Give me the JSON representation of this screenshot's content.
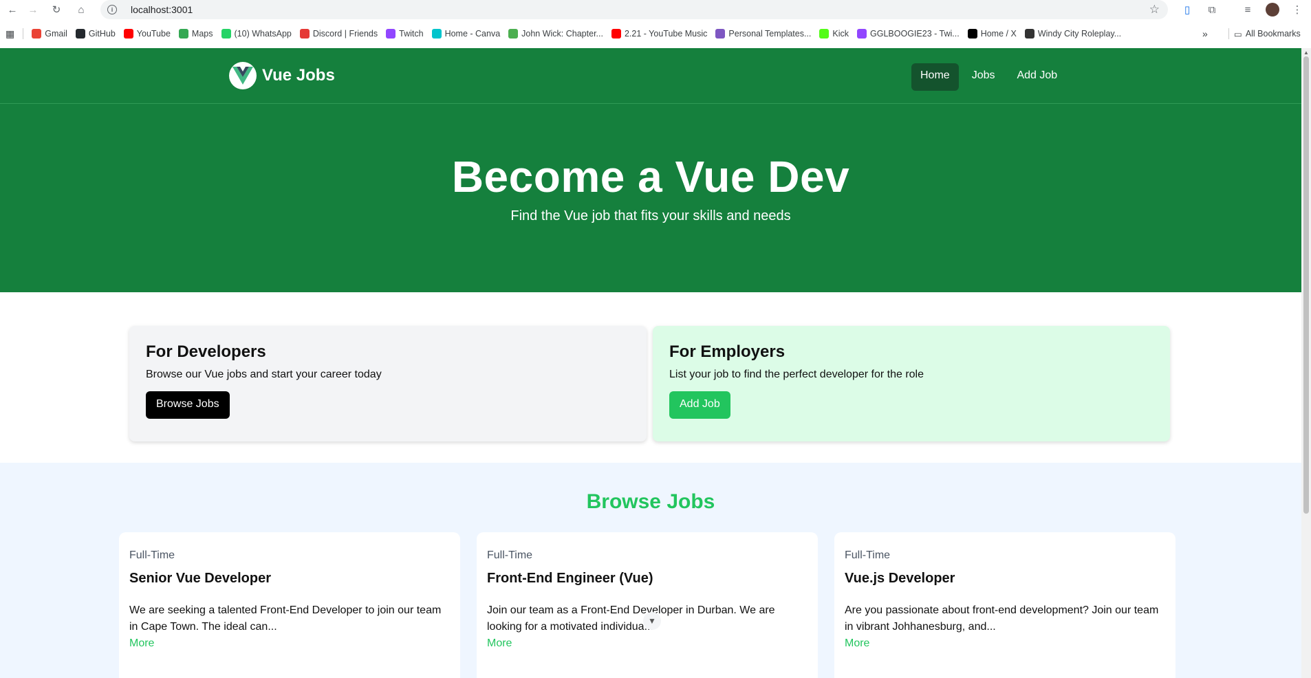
{
  "browser": {
    "url": "localhost:3001",
    "bookmarks": [
      {
        "label": "Gmail",
        "color": "#ea4335"
      },
      {
        "label": "GitHub",
        "color": "#24292e"
      },
      {
        "label": "YouTube",
        "color": "#ff0000"
      },
      {
        "label": "Maps",
        "color": "#34a853"
      },
      {
        "label": "(10) WhatsApp",
        "color": "#25d366"
      },
      {
        "label": "Discord | Friends",
        "color": "#e53935"
      },
      {
        "label": "Twitch",
        "color": "#9146ff"
      },
      {
        "label": "Home - Canva",
        "color": "#00c4cc"
      },
      {
        "label": "John Wick: Chapter...",
        "color": "#4caf50"
      },
      {
        "label": "2.21 - YouTube Music",
        "color": "#ff0000"
      },
      {
        "label": "Personal Templates...",
        "color": "#7e57c2"
      },
      {
        "label": "Kick",
        "color": "#53fc18"
      },
      {
        "label": "GGLBOOGIE23 - Twi...",
        "color": "#9146ff"
      },
      {
        "label": "Home / X",
        "color": "#000000"
      },
      {
        "label": "Windy City Roleplay...",
        "color": "#333333"
      }
    ],
    "all_bookmarks": "All Bookmarks"
  },
  "navbar": {
    "brand": "Vue Jobs",
    "links": [
      "Home",
      "Jobs",
      "Add Job"
    ],
    "active": "Home"
  },
  "hero": {
    "title": "Become a Vue Dev",
    "subtitle": "Find the Vue job that fits your skills and needs"
  },
  "cards": {
    "developers": {
      "title": "For Developers",
      "text": "Browse our Vue jobs and start your career today",
      "button": "Browse Jobs"
    },
    "employers": {
      "title": "For Employers",
      "text": "List your job to find the perfect developer for the role",
      "button": "Add Job"
    }
  },
  "jobs": {
    "title": "Browse Jobs",
    "more_label": "More",
    "items": [
      {
        "type": "Full-Time",
        "title": "Senior Vue Developer",
        "desc": "We are seeking a talented Front-End Developer to join our team in Cape Town. The ideal can..."
      },
      {
        "type": "Full-Time",
        "title": "Front-End Engineer (Vue)",
        "desc": "Join our team as a Front-End Developer in Durban. We are looking for a motivated individua..."
      },
      {
        "type": "Full-Time",
        "title": "Vue.js Developer",
        "desc": "Are you passionate about front-end development? Join our team in vibrant Johhanesburg, and..."
      }
    ]
  },
  "colors": {
    "primary_green": "#15803d",
    "accent_green": "#22c55e",
    "active_nav": "#14532d"
  }
}
